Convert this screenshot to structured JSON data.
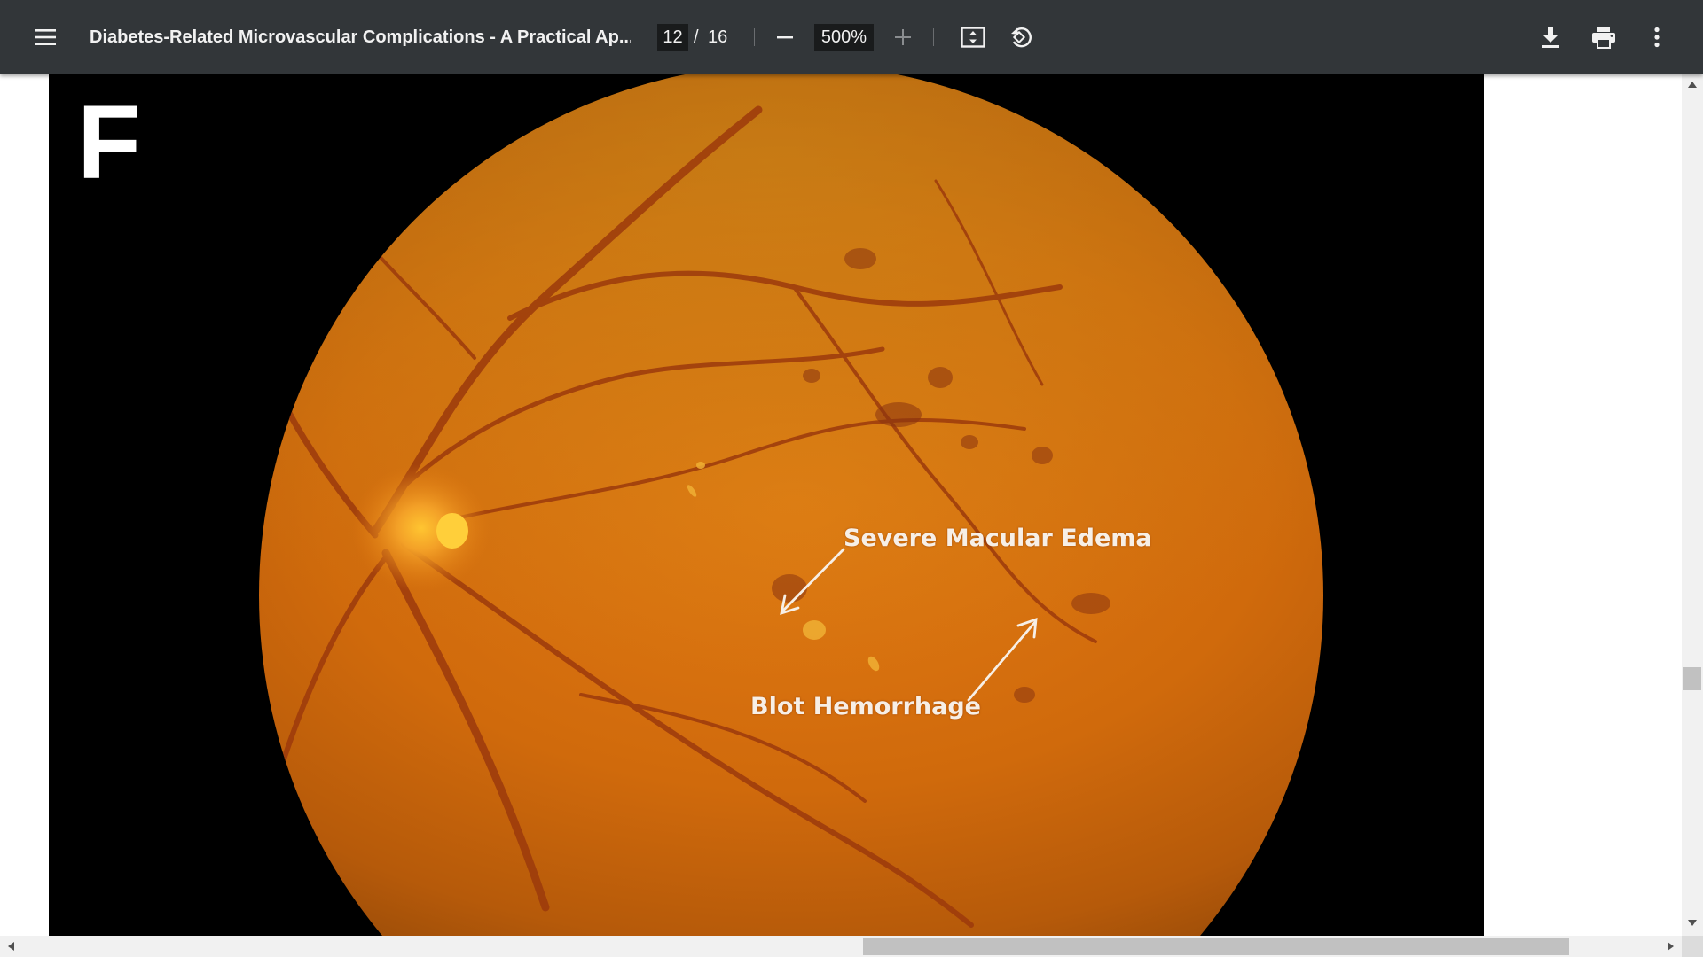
{
  "toolbar": {
    "title": "Diabetes-Related Microvascular Complications - A Practical Ap...",
    "page_current": "12",
    "page_separator": "/",
    "page_total": "16",
    "zoom": "500%",
    "icons": {
      "menu": "menu-icon",
      "zoom_out": "minus-icon",
      "zoom_in": "plus-icon",
      "fit": "fit-to-page-icon",
      "rotate": "rotate-counterclockwise-icon",
      "download": "download-icon",
      "print": "print-icon",
      "more": "more-vert-icon"
    },
    "colors": {
      "background": "#323639",
      "text": "#f1f1f1",
      "input_background": "#191b1c"
    }
  },
  "figure": {
    "panel_letter": "F",
    "annotations": {
      "macular_edema": "Severe Macular Edema",
      "blot_hemorrhage": "Blot Hemorrhage"
    },
    "colors": {
      "background": "#000000",
      "retina": "#d4700e",
      "optic_disc": "#ffb020",
      "vessels": "#9c3a0c"
    }
  }
}
